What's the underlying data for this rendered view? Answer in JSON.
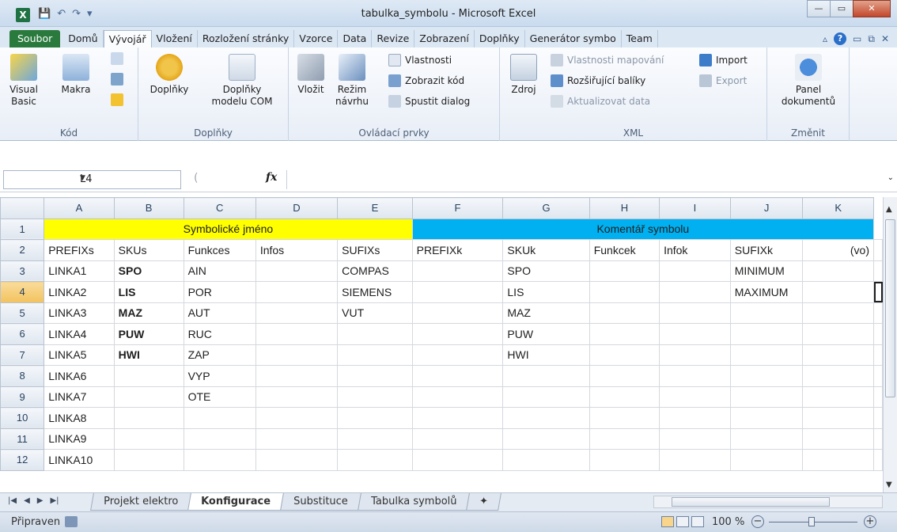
{
  "window": {
    "title": "tabulka_symbolu - Microsoft Excel",
    "app_icon": "X"
  },
  "ribbon_tabs": [
    "Soubor",
    "Domů",
    "Vývojář",
    "Vložení",
    "Rozložení stránky",
    "Vzorce",
    "Data",
    "Revize",
    "Zobrazení",
    "Doplňky",
    "Generátor symbo",
    "Team"
  ],
  "active_tab": "Vývojář",
  "ribbon": {
    "kod": {
      "label": "Kód",
      "visual_basic": "Visual Basic",
      "makra": "Makra"
    },
    "doplnky": {
      "label": "Doplňky",
      "doplnky_btn": "Doplňky",
      "com": "Doplňky modelu COM"
    },
    "ovladaci": {
      "label": "Ovládací prvky",
      "vlozit": "Vložit",
      "rezim": "Režim návrhu",
      "vlastnosti": "Vlastnosti",
      "zobrazit_kod": "Zobrazit kód",
      "spustit_dialog": "Spustit dialog"
    },
    "xml": {
      "label": "XML",
      "zdroj": "Zdroj",
      "vlastnosti_mapovani": "Vlastnosti mapování",
      "rozsirujici": "Rozšiřující balíky",
      "aktualizovat": "Aktualizovat data",
      "import": "Import",
      "export": "Export"
    },
    "zmenit": {
      "label": "Změnit",
      "panel": "Panel dokumentů"
    }
  },
  "formula_bar": {
    "name_box": "L4",
    "fx": "fx",
    "formula": ""
  },
  "columns": [
    "A",
    "B",
    "C",
    "D",
    "E",
    "F",
    "G",
    "H",
    "I",
    "J",
    "K"
  ],
  "rows": [
    {
      "n": "1",
      "cells": []
    },
    {
      "n": "2",
      "cells": [
        "PREFIXs",
        "SKUs",
        "Funkces",
        "Infos",
        "SUFIXs",
        "PREFIXk",
        "SKUk",
        "Funkcek",
        "Infok",
        "SUFIXk",
        "(vo)"
      ]
    },
    {
      "n": "3",
      "cells": [
        "LINKA1",
        "SPO",
        "AIN",
        "",
        "COMPAS",
        "",
        "SPO",
        "",
        "",
        "MINIMUM",
        ""
      ]
    },
    {
      "n": "4",
      "cells": [
        "LINKA2",
        "LIS",
        "POR",
        "",
        "SIEMENS",
        "",
        "LIS",
        "",
        "",
        "MAXIMUM",
        ""
      ]
    },
    {
      "n": "5",
      "cells": [
        "LINKA3",
        "MAZ",
        "AUT",
        "",
        "VUT",
        "",
        "MAZ",
        "",
        "",
        "",
        ""
      ]
    },
    {
      "n": "6",
      "cells": [
        "LINKA4",
        "PUW",
        "RUC",
        "",
        "",
        "",
        "PUW",
        "",
        "",
        "",
        ""
      ]
    },
    {
      "n": "7",
      "cells": [
        "LINKA5",
        "HWI",
        "ZAP",
        "",
        "",
        "",
        "HWI",
        "",
        "",
        "",
        ""
      ]
    },
    {
      "n": "8",
      "cells": [
        "LINKA6",
        "",
        "VYP",
        "",
        "",
        "",
        "",
        "",
        "",
        "",
        ""
      ]
    },
    {
      "n": "9",
      "cells": [
        "LINKA7",
        "",
        "OTE",
        "",
        "",
        "",
        "",
        "",
        "",
        "",
        ""
      ]
    },
    {
      "n": "10",
      "cells": [
        "LINKA8",
        "",
        "",
        "",
        "",
        "",
        "",
        "",
        "",
        "",
        ""
      ]
    },
    {
      "n": "11",
      "cells": [
        "LINKA9",
        "",
        "",
        "",
        "",
        "",
        "",
        "",
        "",
        "",
        ""
      ]
    },
    {
      "n": "12",
      "cells": [
        "LINKA10",
        "",
        "",
        "",
        "",
        "",
        "",
        "",
        "",
        "",
        ""
      ]
    }
  ],
  "merged_headers": {
    "symbolic": "Symbolické jméno",
    "comment": "Komentář symbolu"
  },
  "colors": {
    "yellow": "#ffff00",
    "cyan": "#00b0f0"
  },
  "sheets": [
    "Projekt elektro",
    "Konfigurace",
    "Substituce",
    "Tabulka symbolů"
  ],
  "active_sheet": "Konfigurace",
  "status": {
    "ready": "Připraven",
    "zoom": "100 %"
  }
}
